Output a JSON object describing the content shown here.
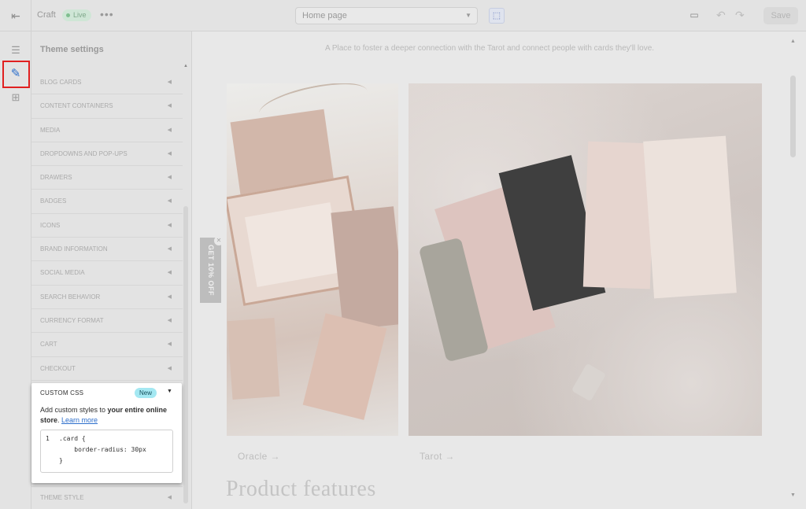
{
  "topbar": {
    "exit_icon": "exit-icon",
    "theme_name": "Craft",
    "status_badge": "Live",
    "more_label": "•••",
    "page_selector": "Home page",
    "save_label": "Save"
  },
  "rail": {
    "items": [
      "sections-icon",
      "theme-settings-icon",
      "apps-icon"
    ],
    "active_item": "theme-settings-icon",
    "highlight_color": "#e02020"
  },
  "panel": {
    "title": "Theme settings",
    "items": [
      {
        "label": "BLOG CARDS"
      },
      {
        "label": "CONTENT CONTAINERS"
      },
      {
        "label": "MEDIA"
      },
      {
        "label": "DROPDOWNS AND POP-UPS"
      },
      {
        "label": "DRAWERS"
      },
      {
        "label": "BADGES"
      },
      {
        "label": "ICONS"
      },
      {
        "label": "BRAND INFORMATION"
      },
      {
        "label": "SOCIAL MEDIA"
      },
      {
        "label": "SEARCH BEHAVIOR"
      },
      {
        "label": "CURRENCY FORMAT"
      },
      {
        "label": "CART"
      },
      {
        "label": "CHECKOUT"
      }
    ],
    "theme_style": "THEME STYLE"
  },
  "custom_css": {
    "title": "CUSTOM CSS",
    "badge": "New",
    "desc_prefix": "Add custom styles to ",
    "desc_bold": "your entire online store",
    "desc_suffix": ". ",
    "learn_more": "Learn more",
    "line_number": "1",
    "code_line1": ".card {",
    "code_line2": "    border-radius: 30px",
    "code_line3": "}"
  },
  "preview": {
    "tagline": "A Place to foster a deeper connection with the Tarot and connect people with cards they'll love.",
    "promo_tab": "GET 10% OFF",
    "collections": [
      {
        "label": "Oracle →"
      },
      {
        "label": "Tarot →"
      }
    ],
    "section_heading": "Product features"
  },
  "colors": {
    "accent": "#2c6ecb",
    "new_badge": "#a4e8f2",
    "live_badge": "#cfe6d6",
    "overlay_gray": "#e6e6e6"
  }
}
